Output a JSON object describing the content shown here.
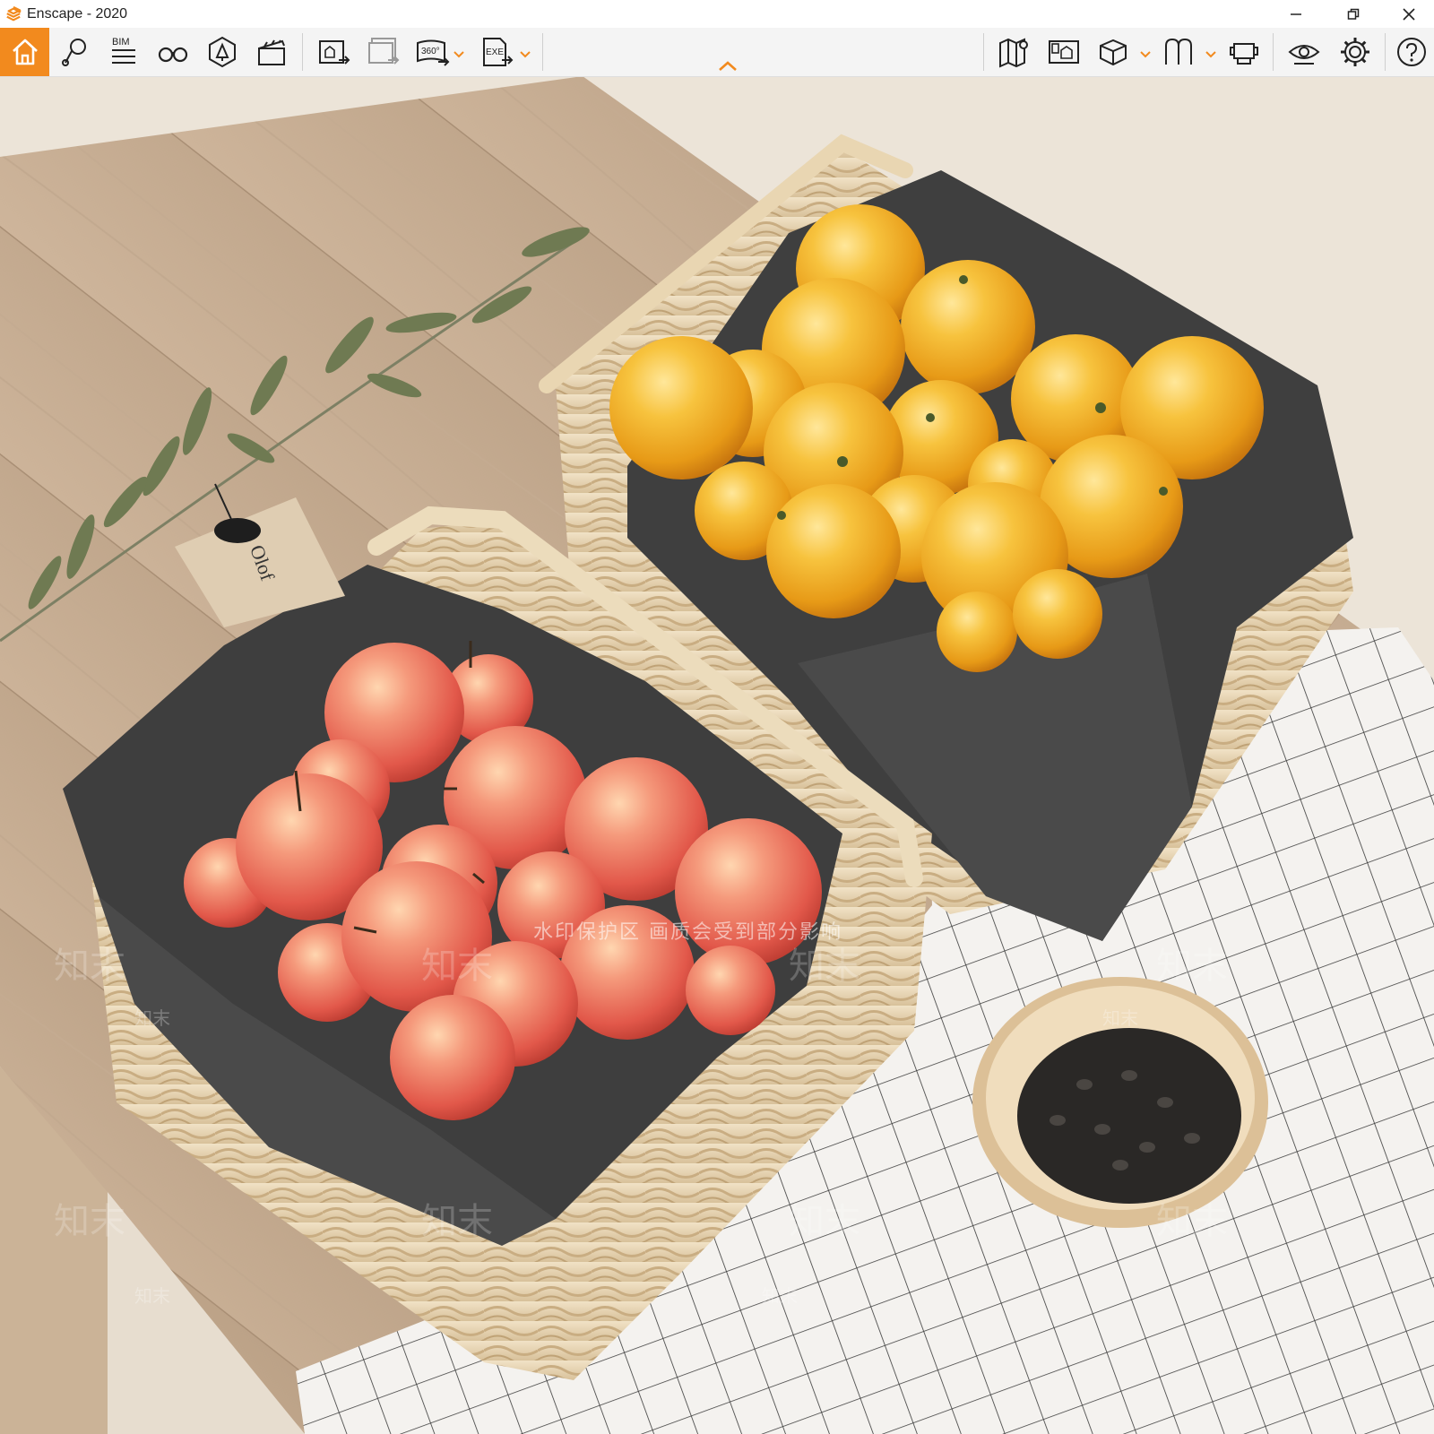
{
  "window": {
    "title": "Enscape - 2020",
    "controls": [
      "minimize",
      "restore",
      "close"
    ]
  },
  "toolbar": {
    "left_tools": [
      {
        "icon": "home-icon"
      },
      {
        "icon": "location-pin-icon"
      },
      {
        "icon": "bim-icon",
        "label": "BIM"
      },
      {
        "icon": "binoculars-icon"
      },
      {
        "icon": "asset-library-icon"
      },
      {
        "icon": "clapper-icon"
      }
    ],
    "export_tools": [
      {
        "icon": "screenshot-export-icon"
      },
      {
        "icon": "batch-export-icon"
      },
      {
        "icon": "panorama-360-icon",
        "label": "360°"
      },
      {
        "icon": "exe-export-icon",
        "label": "EXE"
      }
    ],
    "right_tools": [
      {
        "icon": "map-icon"
      },
      {
        "icon": "view-management-icon"
      },
      {
        "icon": "cube-icon"
      },
      {
        "icon": "sync-views-icon"
      },
      {
        "icon": "vr-headset-icon"
      },
      {
        "icon": "eye-icon"
      },
      {
        "icon": "gear-icon"
      },
      {
        "icon": "help-icon"
      }
    ],
    "accent_color": "#f28a1e"
  },
  "scene": {
    "tag_text": "Olof",
    "watermark_center": "水印保护区 画质会受到部分影响",
    "watermark_logo": "知末"
  }
}
